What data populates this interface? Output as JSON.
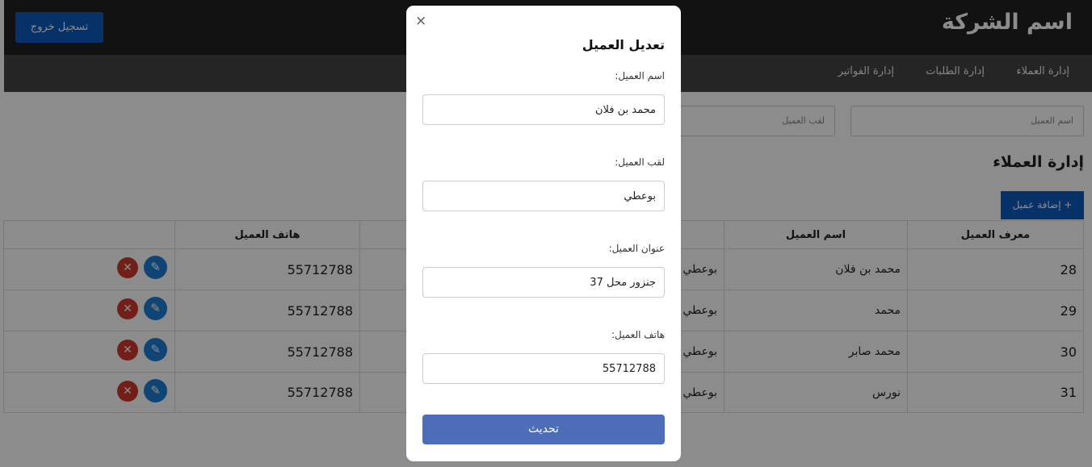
{
  "header": {
    "company_name": "اسم الشركة",
    "logout_label": "تسجيل خروج"
  },
  "nav": {
    "customers": "إدارة العملاء",
    "orders": "إدارة الطلبات",
    "invoices": "إدارة الفواتير"
  },
  "filters": {
    "name_placeholder": "اسم العميل",
    "surname_placeholder": "لقب العميل"
  },
  "section": {
    "title": "إدارة العملاء",
    "add_label": "+ إضافة عميل"
  },
  "table": {
    "headers": {
      "id": "معرف العميل",
      "name": "اسم العميل",
      "surname": "",
      "address": "",
      "phone": "هاتف العميل",
      "actions": ""
    },
    "rows": [
      {
        "id": "28",
        "name": "محمد بن فلان",
        "surname": "بوعطي",
        "phone": "55712788"
      },
      {
        "id": "29",
        "name": "محمد",
        "surname": "بوعطي",
        "phone": "55712788"
      },
      {
        "id": "30",
        "name": "محمد صابر",
        "surname": "بوعطي",
        "phone": "55712788"
      },
      {
        "id": "31",
        "name": "نورس",
        "surname": "بوعطي",
        "phone": "55712788"
      }
    ]
  },
  "modal": {
    "close_glyph": "×",
    "title": "تعديل العميل",
    "fields": [
      {
        "label": "اسم العميل:",
        "value": "محمد بن فلان"
      },
      {
        "label": "لقب العميل:",
        "value": "بوعطي"
      },
      {
        "label": "عنوان العميل:",
        "value": "جنزور محل 37"
      },
      {
        "label": "هاتف العميل:",
        "value": "55712788"
      }
    ],
    "submit_label": "تحديث"
  },
  "icons": {
    "edit": "pencil-icon",
    "delete": "close-circle-icon"
  },
  "colors": {
    "primary": "#0c5cc0",
    "submit": "#4e6db8",
    "edit": "#1c7fd6",
    "delete": "#d0392f"
  }
}
